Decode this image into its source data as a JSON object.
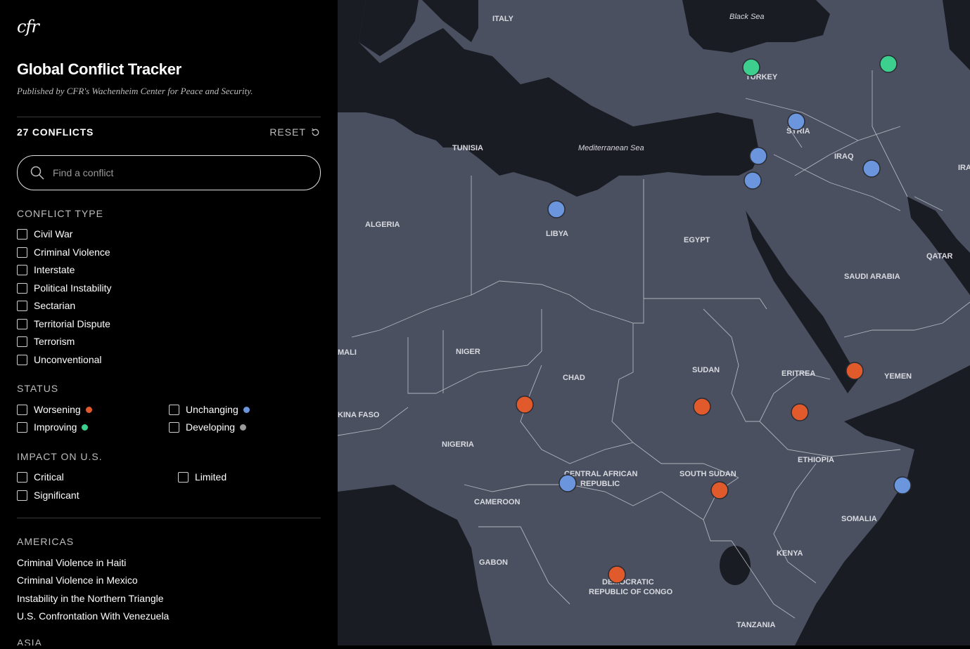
{
  "brand": {
    "logo_text": "cfr"
  },
  "header": {
    "title": "Global Conflict Tracker",
    "subtitle": "Published by CFR's Wachenheim Center for Peace and Security."
  },
  "summary": {
    "count_label": "27 CONFLICTS",
    "reset_label": "RESET"
  },
  "search": {
    "placeholder": "Find a conflict",
    "value": ""
  },
  "filters": {
    "conflict_type": {
      "heading": "CONFLICT TYPE",
      "options": [
        "Civil War",
        "Criminal Violence",
        "Interstate",
        "Political Instability",
        "Sectarian",
        "Territorial Dispute",
        "Terrorism",
        "Unconventional"
      ]
    },
    "status": {
      "heading": "STATUS",
      "options": [
        {
          "label": "Worsening",
          "color": "#e05a2b"
        },
        {
          "label": "Unchanging",
          "color": "#6b95dc"
        },
        {
          "label": "Improving",
          "color": "#3ccf8e"
        },
        {
          "label": "Developing",
          "color": "#9a9a9a"
        }
      ]
    },
    "impact": {
      "heading": "IMPACT ON U.S.",
      "options": [
        "Critical",
        "Limited",
        "Significant"
      ]
    }
  },
  "regions": [
    {
      "heading": "AMERICAS",
      "items": [
        "Criminal Violence in Haiti",
        "Criminal Violence in Mexico",
        "Instability in the Northern Triangle",
        "U.S. Confrontation With Venezuela"
      ]
    },
    {
      "heading": "ASIA",
      "items": []
    }
  ],
  "map": {
    "colors": {
      "land": "#4a5060",
      "water": "#1a1c24",
      "border": "#c9ccd4",
      "label": "#d8dae0"
    },
    "labels": {
      "italy": "ITALY",
      "black_sea": "Black Sea",
      "turkey": "TURKEY",
      "syria": "SYRIA",
      "tunisia": "TUNISIA",
      "mediterranean": "Mediterranean Sea",
      "iraq": "IRAQ",
      "ira": "IRA",
      "algeria": "ALGERIA",
      "libya": "LIBYA",
      "egypt": "EGYPT",
      "qatar": "QATAR",
      "saudi_arabia": "SAUDI ARABIA",
      "mali": "MALI",
      "niger": "NIGER",
      "chad": "CHAD",
      "sudan": "SUDAN",
      "eritrea": "ERITREA",
      "yemen": "YEMEN",
      "burkina": "KINA FASO",
      "nigeria": "NIGERIA",
      "ethiopia": "ETHIOPIA",
      "car_1": "CENTRAL AFRICAN",
      "car_2": "REPUBLIC",
      "south_sudan": "SOUTH SUDAN",
      "cameroon": "CAMEROON",
      "somalia": "SOMALIA",
      "gabon": "GABON",
      "kenya": "KENYA",
      "drc_1": "DEMOCRATIC",
      "drc_2": "REPUBLIC OF CONGO",
      "tanzania": "TANZANIA"
    },
    "markers": [
      {
        "id": "turkey",
        "status": "improving"
      },
      {
        "id": "caucasus",
        "status": "improving"
      },
      {
        "id": "syria",
        "status": "unchanging"
      },
      {
        "id": "lebanon",
        "status": "unchanging"
      },
      {
        "id": "israel",
        "status": "unchanging"
      },
      {
        "id": "iraq",
        "status": "unchanging"
      },
      {
        "id": "libya",
        "status": "unchanging"
      },
      {
        "id": "yemen",
        "status": "worsening"
      },
      {
        "id": "sahel",
        "status": "worsening"
      },
      {
        "id": "sudan",
        "status": "worsening"
      },
      {
        "id": "ethiopia",
        "status": "worsening"
      },
      {
        "id": "car",
        "status": "unchanging"
      },
      {
        "id": "south-sudan",
        "status": "worsening"
      },
      {
        "id": "somalia",
        "status": "unchanging"
      },
      {
        "id": "drc",
        "status": "worsening"
      }
    ]
  }
}
